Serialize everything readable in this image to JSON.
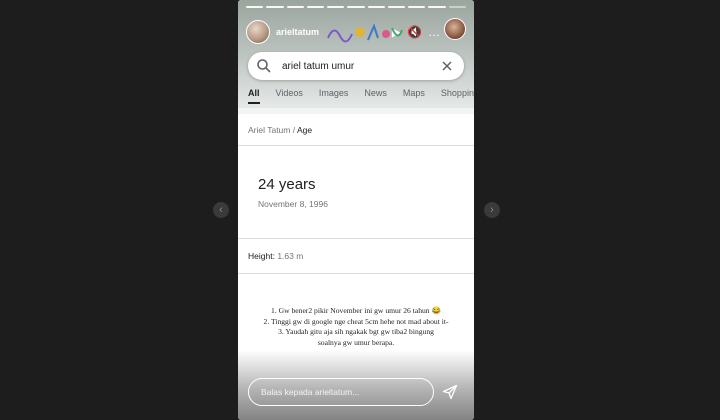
{
  "story": {
    "username": "arieltatum",
    "progress_segments": 11,
    "progress_active_segments": 10
  },
  "search": {
    "query": "ariel tatum umur",
    "tabs": [
      {
        "label": "All",
        "active": true
      },
      {
        "label": "Videos",
        "active": false
      },
      {
        "label": "Images",
        "active": false
      },
      {
        "label": "News",
        "active": false
      },
      {
        "label": "Maps",
        "active": false
      },
      {
        "label": "Shopping",
        "active": false
      }
    ]
  },
  "result": {
    "breadcrumb_parent": "Ariel Tatum",
    "breadcrumb_sep": "/",
    "breadcrumb_current": "Age",
    "answer": "24 years",
    "date": "November 8, 1996",
    "height_label": "Height:",
    "height_value": "1.63 m"
  },
  "caption": {
    "line1": "1. Gw bener2 pikir November ini gw umur 26 tahun 😂",
    "line2": "2. Tinggi gw di google nge cheat 5cm hehe not mad about it-",
    "line3": "3. Yaudah gitu aja sih ngakak bgt gw tiba2 bingung",
    "line4": "soalnya gw umur berapa."
  },
  "reply": {
    "placeholder": "Balas kepada arieltatum..."
  },
  "icons": {
    "prev": "chevron-left-icon",
    "next": "chevron-right-icon",
    "play": "play-icon",
    "mute": "mute-icon",
    "more": "more-icon",
    "search": "search-icon",
    "clear": "close-icon",
    "send": "send-icon"
  }
}
